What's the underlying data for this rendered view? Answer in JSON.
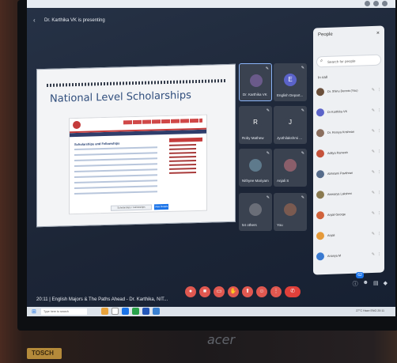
{
  "presenting_banner": "Dr. Karthika VK is presenting",
  "slide": {
    "title": "National Level Scholarships",
    "embed": {
      "section_heading": "Scholarships and Fellowships",
      "prompt_text": "Scholarships / Fellowships",
      "prompt_button": "View Details"
    }
  },
  "tiles": [
    {
      "name": "Dr. Karthika VK",
      "initial": "",
      "color": "#6a5a8a"
    },
    {
      "name": "English Depart...",
      "initial": "E",
      "color": "#5b63c9"
    },
    {
      "name": "Roby Mathew",
      "initial": "R",
      "color": "#3a4250"
    },
    {
      "name": "Jyothilakshmi ...",
      "initial": "J",
      "color": "#3a4250"
    },
    {
      "name": "Nithyee Mariyam",
      "initial": "",
      "color": "#5e7a8c"
    },
    {
      "name": "Anjali S",
      "initial": "",
      "color": "#8a5e6a"
    },
    {
      "name": "54 others",
      "initial": "",
      "color": "#6a6e78"
    },
    {
      "name": "You",
      "initial": "",
      "color": "#7a5a50"
    }
  ],
  "footer": {
    "meeting_time": "20:11",
    "meeting_title": "English Majors & The Paths Ahead - Dr. Karthika, NIT..."
  },
  "people_panel": {
    "heading": "People",
    "close": "×",
    "search_placeholder": "Search for people",
    "section": "In call",
    "participants": [
      {
        "name": "Dr. Shinu Dennis (You)",
        "color": "#6b4f3b"
      },
      {
        "name": "Dr Karthika VK",
        "color": "#5b63c9"
      },
      {
        "name": "Dr. Remya Krishnan",
        "color": "#8a6e5e"
      },
      {
        "name": "Aditya Ramesh",
        "color": "#c5523b"
      },
      {
        "name": "Abhirami Pavithran",
        "color": "#556b8a"
      },
      {
        "name": "Aiswarya Lakshmi",
        "color": "#8a7a50"
      },
      {
        "name": "Anjali George",
        "color": "#d0623b"
      },
      {
        "name": "Anjali",
        "color": "#e59a3a"
      },
      {
        "name": "Ananya M",
        "color": "#3a7ad0"
      }
    ]
  },
  "taskbar": {
    "search_placeholder": "Type here to search",
    "tray_text": "27°C Haze  ENG  20:11"
  },
  "brand": "acer",
  "sticker": "TOSCH"
}
